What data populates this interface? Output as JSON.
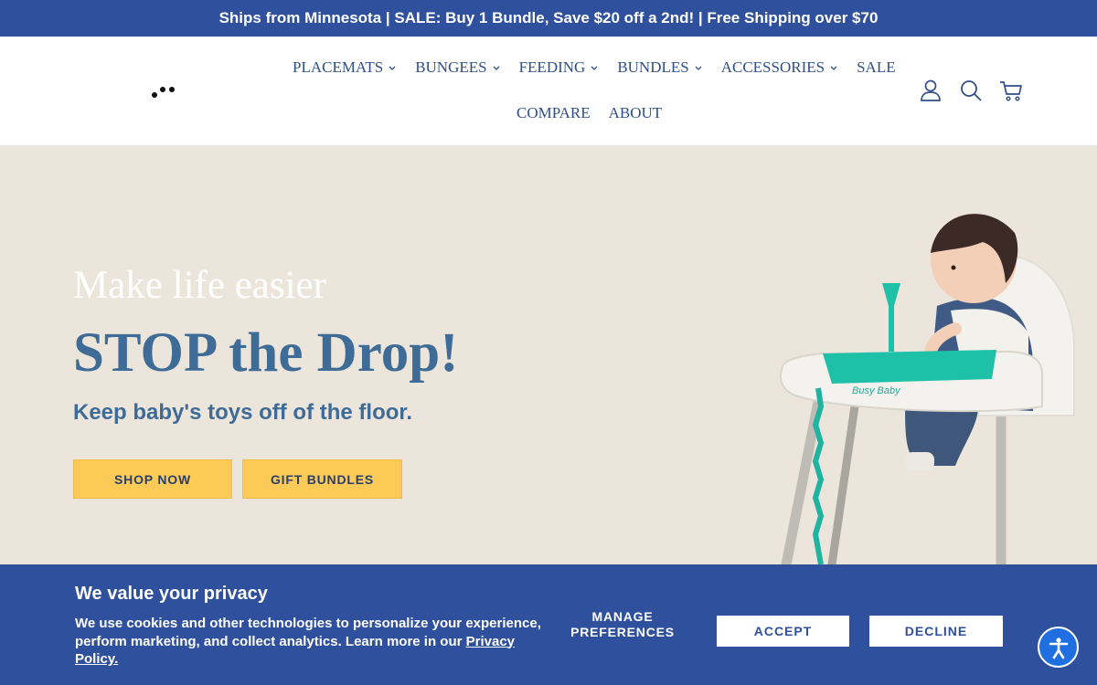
{
  "announcement": "Ships from Minnesota | SALE: Buy 1 Bundle, Save $20 off a 2nd! | Free Shipping over $70",
  "nav": {
    "row1": [
      {
        "label": "PLACEMATS",
        "dropdown": true
      },
      {
        "label": "BUNGEES",
        "dropdown": true
      },
      {
        "label": "FEEDING",
        "dropdown": true
      },
      {
        "label": "BUNDLES",
        "dropdown": true
      },
      {
        "label": "ACCESSORIES",
        "dropdown": true
      },
      {
        "label": "SALE",
        "dropdown": false
      }
    ],
    "row2": [
      {
        "label": "COMPARE"
      },
      {
        "label": "ABOUT"
      }
    ]
  },
  "header_icons": [
    "account-icon",
    "search-icon",
    "cart-icon"
  ],
  "hero": {
    "subtitle": "Make life easier",
    "title": "STOP the Drop!",
    "tagline": "Keep baby's toys off of the floor.",
    "btn_shop": "SHOP NOW",
    "btn_gifts": "GIFT BUNDLES",
    "product_mark": "Busy Baby"
  },
  "cookie": {
    "title": "We value your privacy",
    "text": "We use cookies and other technologies to personalize your experience, perform marketing, and collect analytics. Learn more in our ",
    "link": "Privacy Policy.",
    "manage": "MANAGE PREFERENCES",
    "accept": "ACCEPT",
    "decline": "DECLINE"
  },
  "colors": {
    "brand_blue": "#2f509c",
    "hero_bg": "#ece5db",
    "button_yellow": "#fccb57",
    "heading_blue": "#3f6b97",
    "placemat_teal": "#1fc0a8"
  }
}
